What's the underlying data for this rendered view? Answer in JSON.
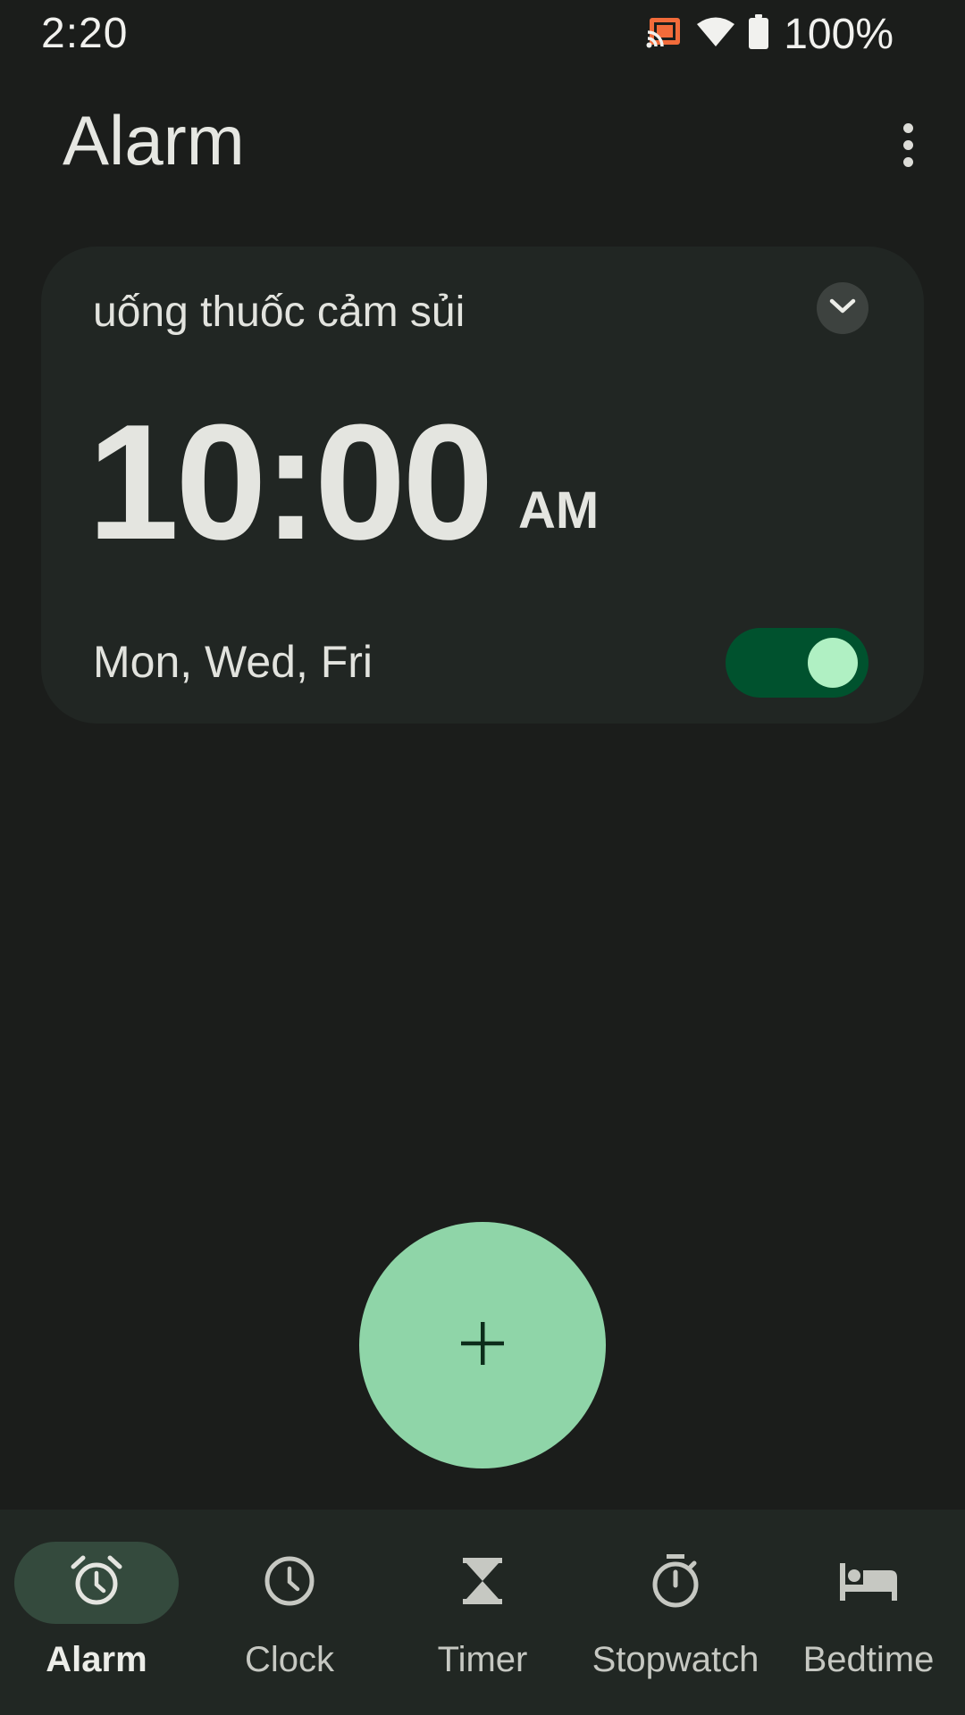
{
  "status_bar": {
    "time": "2:20",
    "battery_text": "100%",
    "icons": [
      "cast-icon",
      "wifi-icon",
      "battery-icon"
    ]
  },
  "header": {
    "title": "Alarm",
    "overflow_icon": "more-vert-icon"
  },
  "alarm": {
    "label": "uống thuốc cảm sủi",
    "time": "10:00",
    "ampm": "AM",
    "days": "Mon, Wed, Fri",
    "enabled": true
  },
  "fab": {
    "icon": "plus-icon"
  },
  "nav": {
    "items": [
      {
        "label": "Alarm",
        "icon": "alarm-icon",
        "active": true
      },
      {
        "label": "Clock",
        "icon": "clock-icon",
        "active": false
      },
      {
        "label": "Timer",
        "icon": "hourglass-icon",
        "active": false
      },
      {
        "label": "Stopwatch",
        "icon": "stopwatch-icon",
        "active": false
      },
      {
        "label": "Bedtime",
        "icon": "bed-icon",
        "active": false
      }
    ]
  },
  "colors": {
    "background": "#1b1d1b",
    "card": "#212623",
    "accent": "#8fd5a8",
    "toggle_track": "#00522e",
    "toggle_knob": "#b0f0c3",
    "cast_icon": "#f26b3a"
  }
}
